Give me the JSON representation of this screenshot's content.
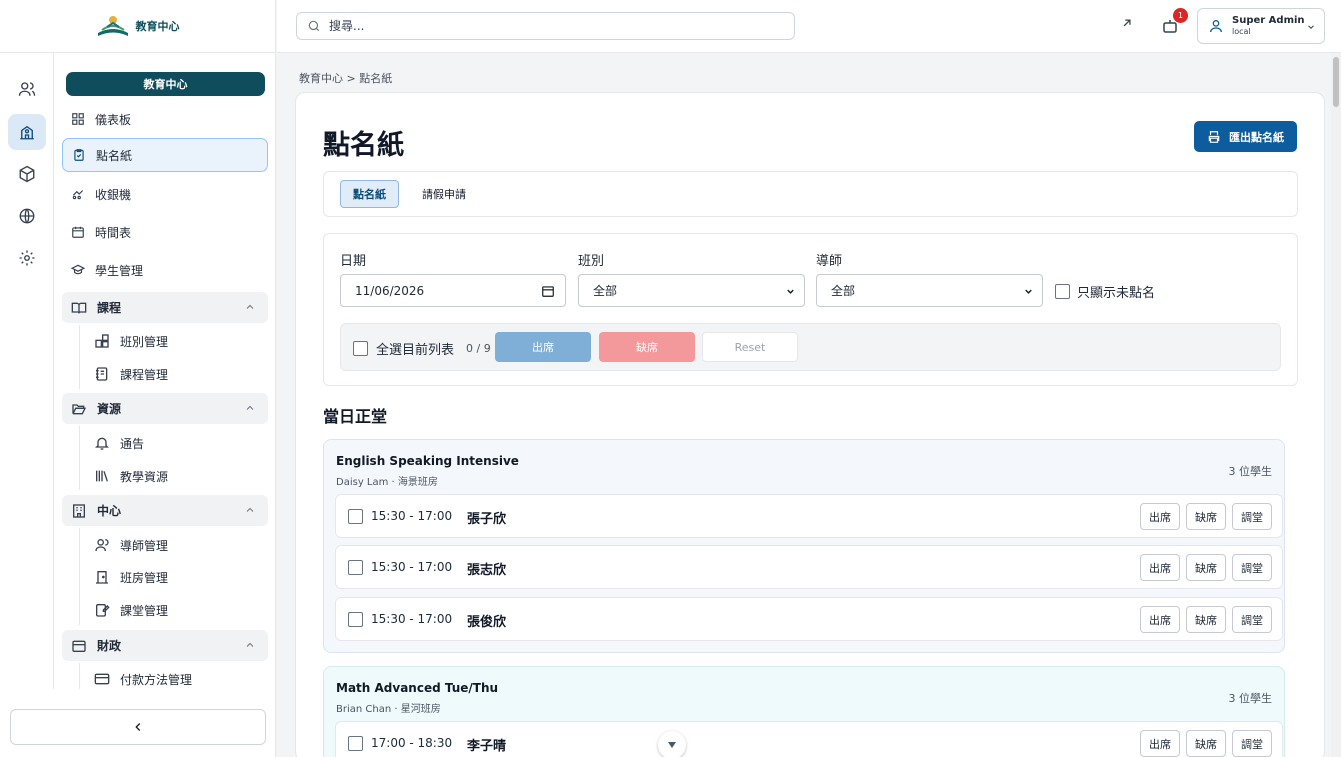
{
  "brand": {
    "name": "教育中心"
  },
  "sidebar": {
    "center_chip": "教育中心",
    "items": [
      {
        "label": "儀表板",
        "icon": "dashboard-icon"
      },
      {
        "label": "點名紙",
        "icon": "clipboard-check-icon",
        "active": true
      },
      {
        "label": "收銀機",
        "icon": "cash-register-icon"
      },
      {
        "label": "時間表",
        "icon": "calendar-icon"
      },
      {
        "label": "學生管理",
        "icon": "graduation-cap-icon"
      }
    ],
    "groups": [
      {
        "label": "課程",
        "icon": "book-open-icon",
        "children": [
          {
            "label": "班別管理",
            "icon": "blocks-icon"
          },
          {
            "label": "課程管理",
            "icon": "notebook-icon"
          }
        ]
      },
      {
        "label": "資源",
        "icon": "folder-open-icon",
        "children": [
          {
            "label": "通告",
            "icon": "bell-icon"
          },
          {
            "label": "教學資源",
            "icon": "library-icon"
          }
        ]
      },
      {
        "label": "中心",
        "icon": "building-icon",
        "children": [
          {
            "label": "導師管理",
            "icon": "user-icon"
          },
          {
            "label": "班房管理",
            "icon": "door-icon"
          },
          {
            "label": "課堂管理",
            "icon": "edit-notebook-icon"
          }
        ]
      },
      {
        "label": "財政",
        "icon": "wallet-icon",
        "children": [
          {
            "label": "付款方法管理",
            "icon": "credit-card-icon"
          }
        ]
      }
    ]
  },
  "header": {
    "search_placeholder": "搜尋...",
    "notification_count": "1",
    "user": {
      "name": "Super Admin",
      "sub": "local"
    }
  },
  "breadcrumb": "教育中心 > 點名紙",
  "page": {
    "title": "點名紙",
    "export_label": "匯出點名紙",
    "tabs": [
      {
        "label": "點名紙",
        "active": true
      },
      {
        "label": "請假申請"
      }
    ]
  },
  "filters": {
    "date_label": "日期",
    "date_value": "11/06/2026",
    "class_label": "班別",
    "class_value": "全部",
    "tutor_label": "導師",
    "tutor_value": "全部",
    "only_unmarked_label": "只顯示未點名",
    "select_all_label": "全選目前列表",
    "selected_count": "0 / 9",
    "present_label": "出席",
    "absent_label": "缺席",
    "reset_label": "Reset"
  },
  "section_title": "當日正堂",
  "row_actions": {
    "present": "出席",
    "absent": "缺席",
    "transfer": "調堂"
  },
  "groups": [
    {
      "title": "English Speaking Intensive",
      "subtitle": "Daisy Lam · 海景班房",
      "count": "3 位學生",
      "rows": [
        {
          "time": "15:30 - 17:00",
          "name": "張子欣"
        },
        {
          "time": "15:30 - 17:00",
          "name": "張志欣"
        },
        {
          "time": "15:30 - 17:00",
          "name": "張俊欣"
        }
      ]
    },
    {
      "title": "Math Advanced Tue/Thu",
      "subtitle": "Brian Chan · 星河班房",
      "count": "3 位學生",
      "rows": [
        {
          "time": "17:00 - 18:30",
          "name": "李子晴"
        }
      ]
    }
  ],
  "colors": {
    "primary": "#0d5c9e",
    "brand_dark": "#0f4c5c",
    "present_disabled": "#7fafd6",
    "absent_disabled": "#f4999b"
  }
}
